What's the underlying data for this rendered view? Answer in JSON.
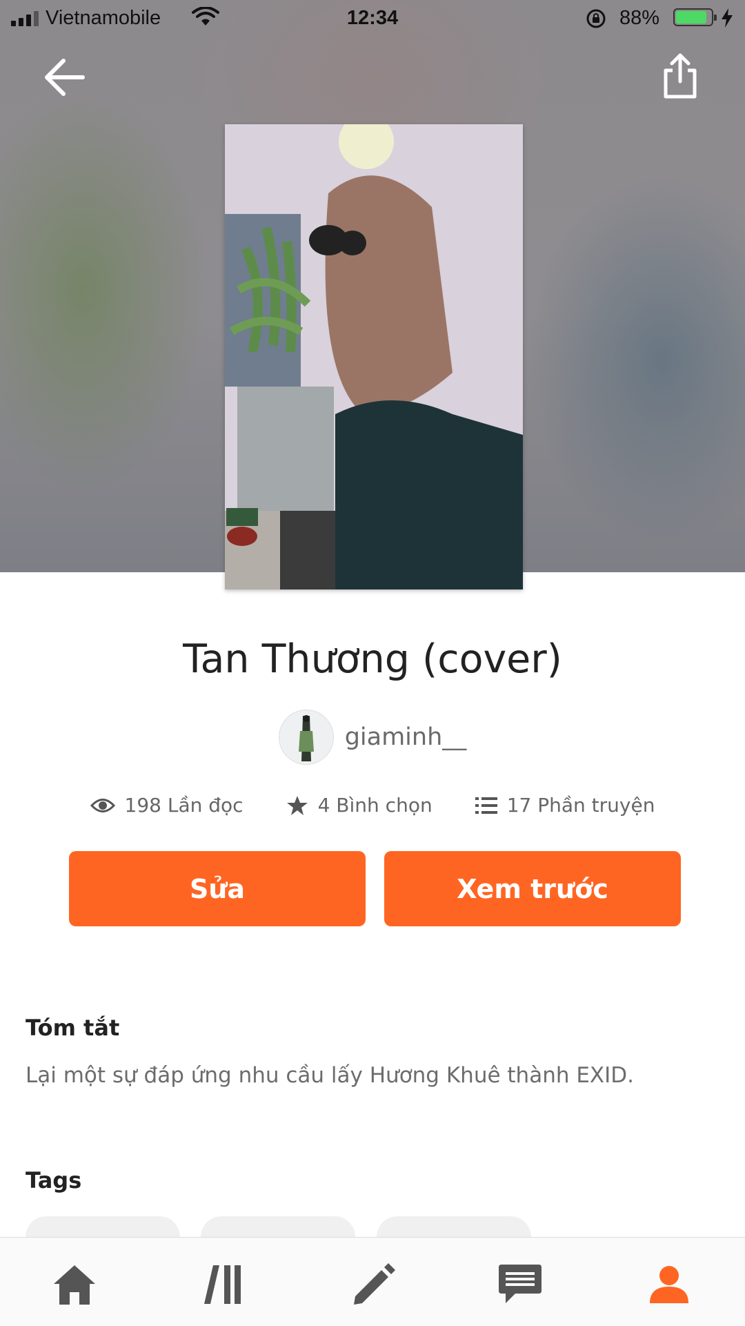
{
  "status_bar": {
    "carrier": "Vietnamobile",
    "time": "12:34",
    "battery_percent": "88%",
    "battery_level": 0.88,
    "icons": [
      "signal-icon",
      "wifi-icon",
      "rotation-lock-icon",
      "battery-icon",
      "charging-icon"
    ]
  },
  "header": {
    "back_icon": "arrow-left-icon",
    "share_icon": "share-icon"
  },
  "story": {
    "title": "Tan Thương (cover)",
    "author": "giaminh__",
    "stats": {
      "reads": "198 Lần đọc",
      "votes": "4 Bình chọn",
      "parts": "17 Phần truyện"
    }
  },
  "actions": {
    "edit_label": "Sửa",
    "preview_label": "Xem trước"
  },
  "summary": {
    "heading": "Tóm tắt",
    "text": "Lại một sự đáp ứng nhu cầu lấy Hương Khuê thành EXID."
  },
  "tags": {
    "heading": "Tags"
  },
  "tab_bar": {
    "items": [
      "home-icon",
      "library-icon",
      "write-icon",
      "messages-icon",
      "profile-icon"
    ],
    "active": "profile-icon"
  },
  "colors": {
    "accent": "#ff6522",
    "active_tab": "#ff6522",
    "inactive_tab": "#555555"
  }
}
